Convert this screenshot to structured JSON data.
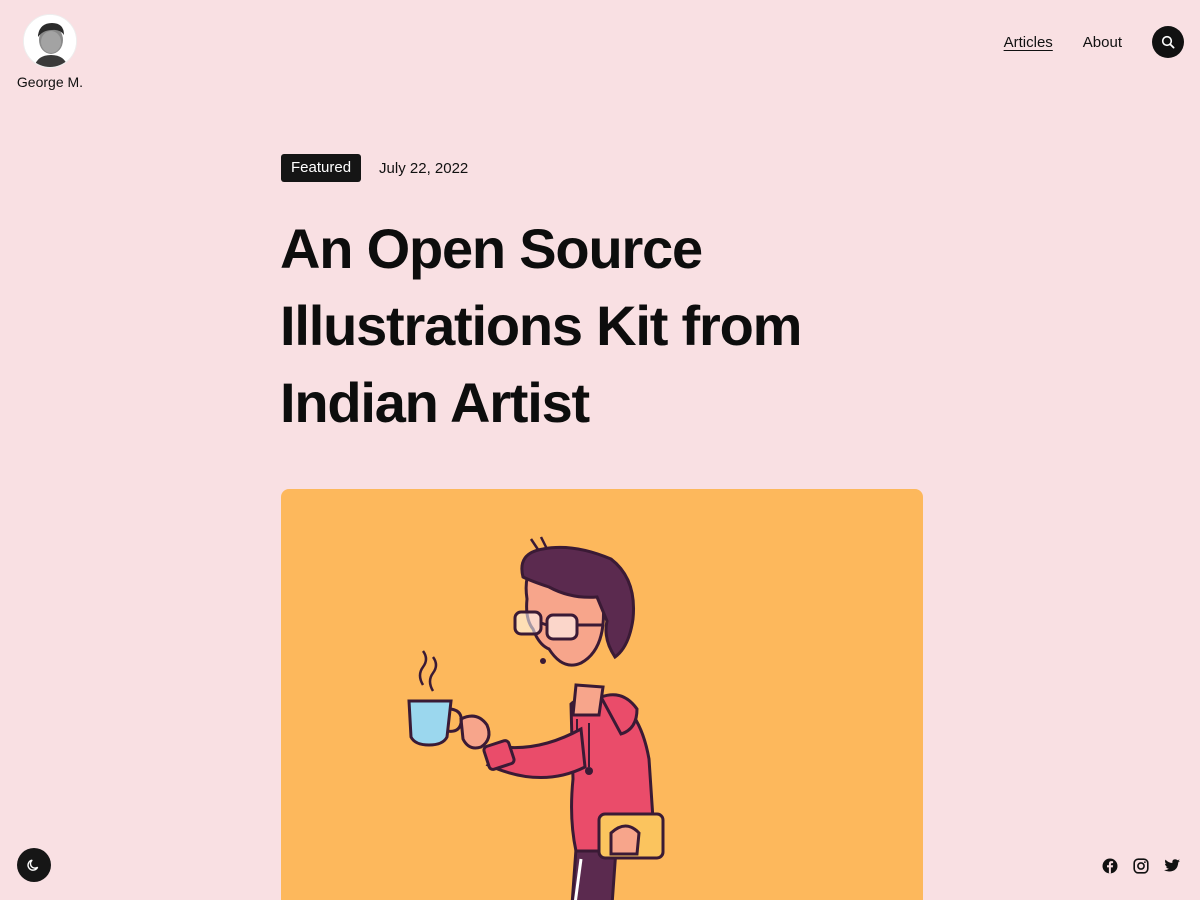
{
  "site": {
    "author_name": "George M."
  },
  "nav": {
    "items": [
      {
        "label": "Articles",
        "active": true
      },
      {
        "label": "About",
        "active": false
      }
    ],
    "search_icon": "search-icon"
  },
  "post": {
    "badge": "Featured",
    "date": "July 22, 2022",
    "title": "An Open Source Illustrations Kit from Indian Artist",
    "hero_background": "#fdb85c"
  },
  "footer": {
    "theme_toggle_icon": "moon-icon",
    "social": [
      "facebook-icon",
      "instagram-icon",
      "twitter-icon"
    ]
  },
  "colors": {
    "page_background": "#f9e0e3",
    "text": "#111111",
    "badge_background": "#151515"
  }
}
